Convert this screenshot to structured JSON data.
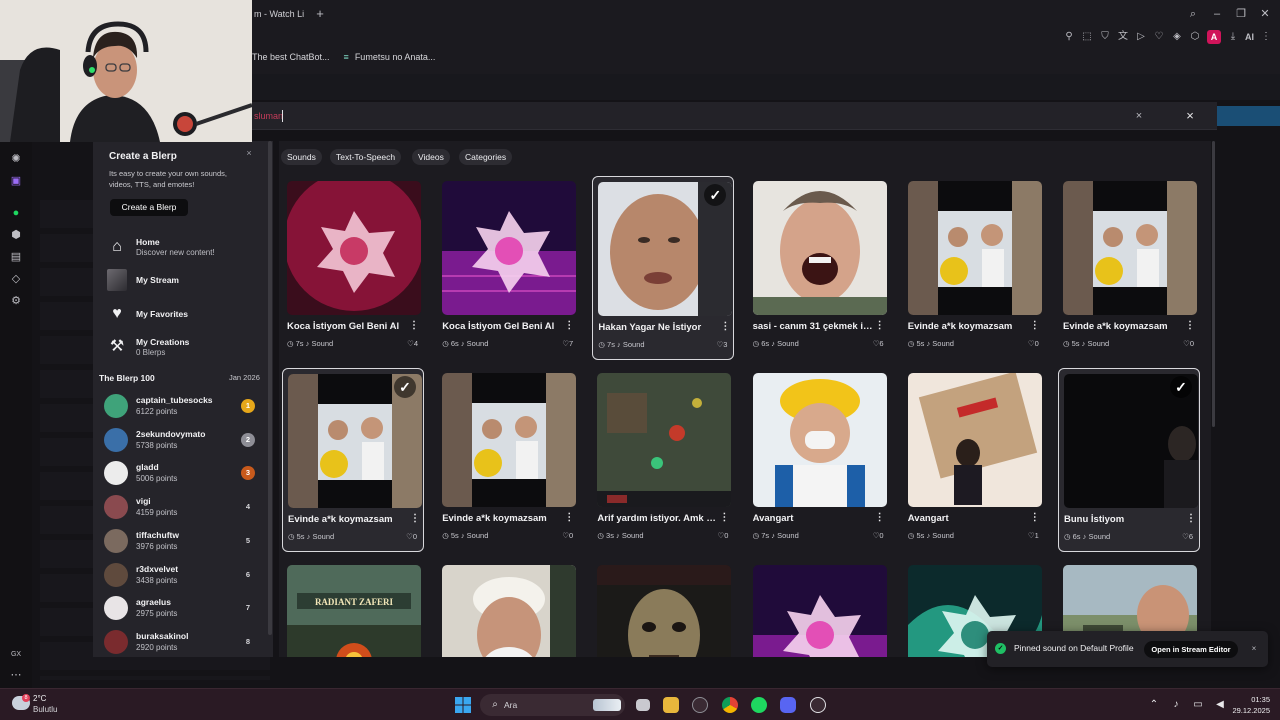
{
  "browser": {
    "tab_title": "m - Watch Li",
    "new_tab": "+",
    "bookmarks": [
      {
        "label": "The best ChatBot..."
      },
      {
        "label": "Fumetsu no Anata..."
      }
    ],
    "toolbar_ai": "AI",
    "extension_badge": "A"
  },
  "search": {
    "query": "sluman",
    "clear": "×",
    "close": "×"
  },
  "sidebar": {
    "create_title": "Create a Blerp",
    "create_desc": "Its easy to create your own sounds, videos, TTS, and emotes!",
    "create_button": "Create a Blerp",
    "close": "×",
    "nav": [
      {
        "title": "Home",
        "sub": "Discover new content!"
      },
      {
        "title": "My Stream",
        "sub": ""
      },
      {
        "title": "My Favorites",
        "sub": ""
      },
      {
        "title": "My Creations",
        "sub": "0 Blerps"
      }
    ],
    "leaderboard_title": "The Blerp 100",
    "leaderboard_date": "Jan 2026",
    "leaders": [
      {
        "name": "captain_tubesocks",
        "points": "6122 points",
        "rank": "1",
        "rank_color": "#e6a71a",
        "avatar_color": "#3fa37a"
      },
      {
        "name": "2sekundovymato",
        "points": "5738 points",
        "rank": "2",
        "rank_color": "#8e8e96",
        "avatar_color": "#3a6fa8"
      },
      {
        "name": "gladd",
        "points": "5006 points",
        "rank": "3",
        "rank_color": "#c85a1c",
        "avatar_color": "#ececec"
      },
      {
        "name": "vigi",
        "points": "4159 points",
        "rank": "4",
        "rank_color": "",
        "avatar_color": "#8a4a4f"
      },
      {
        "name": "tiffachuftw",
        "points": "3976 points",
        "rank": "5",
        "rank_color": "",
        "avatar_color": "#7b6a5f"
      },
      {
        "name": "r3dxvelvet",
        "points": "3438 points",
        "rank": "6",
        "rank_color": "",
        "avatar_color": "#5f4a3d"
      },
      {
        "name": "agraelus",
        "points": "2975 points",
        "rank": "7",
        "rank_color": "",
        "avatar_color": "#e8e4e6"
      },
      {
        "name": "buraksakinol",
        "points": "2920 points",
        "rank": "8",
        "rank_color": "",
        "avatar_color": "#7a2b2e"
      }
    ]
  },
  "filters": [
    "Sounds",
    "Text-To-Speech",
    "Videos",
    "Categories"
  ],
  "cards": [
    {
      "title": "Koca İstiyom Gel Beni Al",
      "duration": "7s",
      "type": "Sound",
      "likes": "4",
      "selected": false,
      "thumb": "pink-blerp"
    },
    {
      "title": "Koca İstiyom Gel Beni Al",
      "duration": "6s",
      "type": "Sound",
      "likes": "7",
      "selected": false,
      "thumb": "synth-blerp"
    },
    {
      "title": "Hakan Yagar Ne İstiyor",
      "duration": "7s",
      "type": "Sound",
      "likes": "3",
      "selected": true,
      "thumb": "face"
    },
    {
      "title": "sasi - canım 31 çekmek istiyor",
      "duration": "6s",
      "type": "Sound",
      "likes": "6",
      "selected": false,
      "thumb": "scream"
    },
    {
      "title": "Evinde a*k koymazsam",
      "duration": "5s",
      "type": "Sound",
      "likes": "0",
      "selected": false,
      "thumb": "men"
    },
    {
      "title": "Evinde a*k koymazsam",
      "duration": "5s",
      "type": "Sound",
      "likes": "0",
      "selected": false,
      "thumb": "men"
    },
    {
      "title": "Evinde a*k koymazsam",
      "duration": "5s",
      "type": "Sound",
      "likes": "0",
      "selected": true,
      "thumb": "men"
    },
    {
      "title": "Evinde a*k koymazsam",
      "duration": "5s",
      "type": "Sound",
      "likes": "0",
      "selected": false,
      "thumb": "men"
    },
    {
      "title": "Arif yardım istiyor. Amk hey",
      "duration": "3s",
      "type": "Sound",
      "likes": "0",
      "selected": false,
      "thumb": "game"
    },
    {
      "title": "Avangart",
      "duration": "7s",
      "type": "Sound",
      "likes": "0",
      "selected": false,
      "thumb": "worker"
    },
    {
      "title": "Avangart",
      "duration": "5s",
      "type": "Sound",
      "likes": "1",
      "selected": false,
      "thumb": "box"
    },
    {
      "title": "Bunu İstiyom",
      "duration": "6s",
      "type": "Sound",
      "likes": "6",
      "selected": true,
      "thumb": "dark"
    },
    {
      "title": "",
      "duration": "",
      "type": "",
      "likes": "",
      "selected": false,
      "thumb": "radiant"
    },
    {
      "title": "",
      "duration": "",
      "type": "",
      "likes": "",
      "selected": false,
      "thumb": "oldman"
    },
    {
      "title": "",
      "duration": "",
      "type": "",
      "likes": "",
      "selected": false,
      "thumb": "horror"
    },
    {
      "title": "",
      "duration": "",
      "type": "",
      "likes": "",
      "selected": false,
      "thumb": "synth-blerp"
    },
    {
      "title": "",
      "duration": "",
      "type": "",
      "likes": "",
      "selected": false,
      "thumb": "teal-blerp"
    },
    {
      "title": "",
      "duration": "",
      "type": "",
      "likes": "",
      "selected": false,
      "thumb": "outdoor"
    }
  ],
  "thumb_texts": {
    "radiant": "RADIANT ZAFERI"
  },
  "toast": {
    "text": "Pinned sound on Default Profile",
    "button": "Open in Stream Editor",
    "close": "×"
  },
  "taskbar": {
    "temperature": "2°C",
    "weather": "Bulutlu",
    "search_placeholder": "Ara",
    "time": "01:35",
    "date": "29.12.2025"
  },
  "rail_label": "GX",
  "colors": {
    "accent_pink": "#e0246a",
    "toast_success": "#1fbf64",
    "rank_gold": "#e6a71a",
    "rank_silver": "#8e8e96",
    "rank_bronze": "#c85a1c"
  }
}
